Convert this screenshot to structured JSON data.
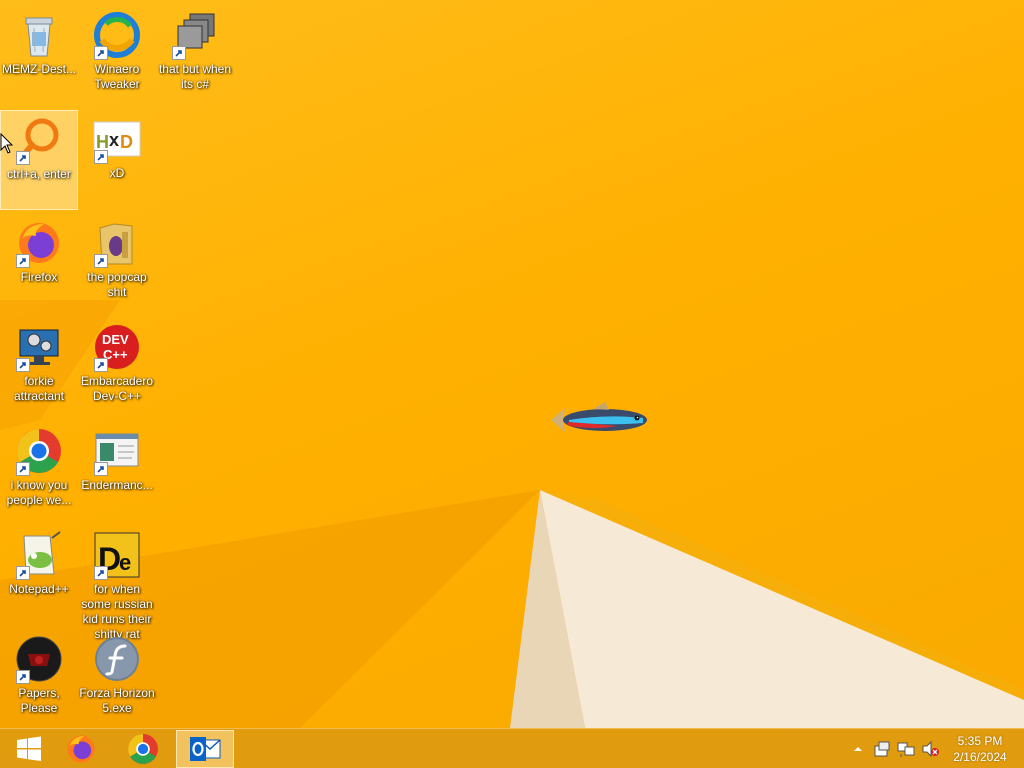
{
  "desktop": {
    "icons": [
      {
        "label": "MEMZ-Dest...",
        "icon": "recycle-bin-icon"
      },
      {
        "label": "Winaero Tweaker",
        "icon": "winaero-icon"
      },
      {
        "label": "that but when its c#",
        "icon": "stacked-windows-icon"
      },
      {
        "label": "ctrl+a, enter",
        "icon": "magnifier-icon"
      },
      {
        "label": "xD",
        "icon": "hxd-icon"
      },
      {
        "label": "Firefox",
        "icon": "firefox-icon"
      },
      {
        "label": "the popcap shit",
        "icon": "folder-icon"
      },
      {
        "label": "forkie attractant",
        "icon": "computer-settings-icon"
      },
      {
        "label": "Embarcadero Dev-C++",
        "icon": "devcpp-icon"
      },
      {
        "label": "i know you people we...",
        "icon": "chrome-icon"
      },
      {
        "label": "Endermanc...",
        "icon": "window-app-icon"
      },
      {
        "label": "Notepad++",
        "icon": "notepad-plus-plus-icon"
      },
      {
        "label": "for when some russian kid runs their shitty rat",
        "icon": "de-icon"
      },
      {
        "label": "Papers, Please",
        "icon": "papers-please-icon"
      },
      {
        "label": "Forza Horizon 5.exe",
        "icon": "flash-icon"
      }
    ]
  },
  "taskbar": {
    "start_icon": "windows-start-icon",
    "pinned": [
      {
        "name": "Firefox",
        "icon": "firefox-icon"
      },
      {
        "name": "Chrome",
        "icon": "chrome-icon"
      },
      {
        "name": "Outlook",
        "icon": "outlook-icon"
      }
    ],
    "tray": [
      "show-hidden-icons-chevron",
      "action-center-icon",
      "network-icon",
      "volume-muted-icon"
    ],
    "clock": {
      "time": "5:35 PM",
      "date": "2/16/2024"
    }
  },
  "colors": {
    "wallpaper": "#ffb300",
    "taskbar": "#d6961a",
    "selection": "#fff6dc"
  }
}
